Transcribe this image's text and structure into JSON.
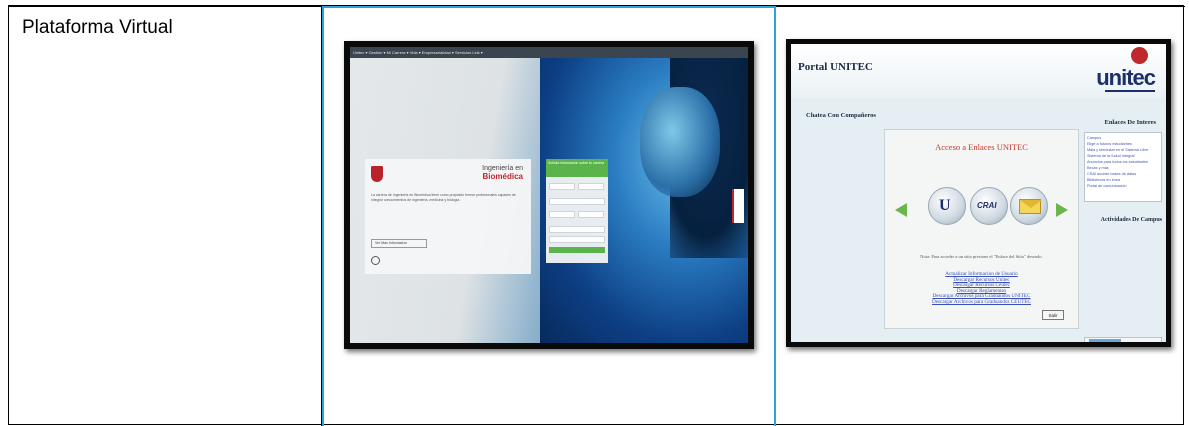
{
  "row": {
    "label": "Plataforma Virtual"
  },
  "screenshot_left": {
    "nav_text": "Unitec ▾  Gestión ▾  Mi Carrera ▾  Vida ▾  Empresarialidad ▾  Servicios Link ▾",
    "card_title_top": "Ingeniería en",
    "card_title_bottom": "Biomédica",
    "card_body": "La carrera de Ingeniería en Biomédica tiene como propósito formar profesionales capaces de integrar conocimientos de ingeniería, medicina y biología.",
    "card_button": "Ver Mas Informacion",
    "form_header": "Solicita información sobre tu carrera",
    "form_submit": "ENVIAR INFORMACION"
  },
  "screenshot_right": {
    "title": "Portal UNITEC",
    "logo_text": "unitec",
    "chat_label": "Chatea Con Compañeros",
    "enlaces_title": "Enlaces De Interes",
    "link_list": [
      "Campus",
      "Elige a futuros estudiantes",
      "Mala y bienestar en el Sistema Libre",
      "Sistema de la Salud Integral",
      "Anuncios para todos los estudiantes",
      "Becas y más",
      "CRAI accede bases de datos",
      "Bibliotecas en línea",
      "Portal de comunicación"
    ],
    "actividades_title": "Actividades De Campus",
    "panel_title": "Acceso a Enlaces UNITEC",
    "note": "Nota: Para acceder a un sitio presione el \"Enlace del Sitio\" deseado.",
    "links": [
      "Actualizar Informacion de Usuario",
      "Descargar Recursos Unitec",
      "Descargar Recursos Ceutec",
      "Descargar Reglamentos",
      "Descargar Archivos para Graduandos UNITEC",
      "Descargar Archivos para Graduandos CEUTEC"
    ],
    "salir_label": "Salir"
  },
  "colors": {
    "accent_blue": "#2fa0dc",
    "green": "#5bb44b",
    "unitec_red": "#c0282e",
    "unitec_navy": "#1c2f6b"
  }
}
